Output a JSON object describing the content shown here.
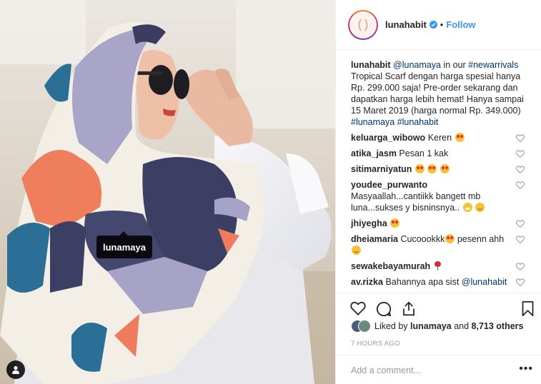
{
  "photo": {
    "tag_label": "lunamaya",
    "colors": {
      "scarf_cream": "#f3efe6",
      "scarf_navy": "#3c3e63",
      "scarf_lavender": "#a7a3c6",
      "scarf_coral": "#ee7b5d",
      "scarf_teal": "#2c6f96"
    }
  },
  "header": {
    "username": "lunahabit",
    "separator": "•",
    "follow_label": "Follow"
  },
  "caption": {
    "username": "lunahabit",
    "mention": "@lunamaya",
    "text_1": " in our ",
    "hashtag_1": "#newarrivals",
    "text_2": " Tropical Scarf dengan harga spesial hanya Rp. 299.000 saja! Pre-order sekarang dan dapatkan harga lebih hemat! Hanya sampai 15 Maret 2019 (harga normal Rp. 349.000) ",
    "hashtag_2": "#lunamaya",
    "hashtag_3": "#lunahabit"
  },
  "comments": [
    {
      "user": "keluarga_wibowo",
      "text": "Keren"
    },
    {
      "user": "atika_jasm",
      "text": "Pesan 1 kak"
    },
    {
      "user": "sitimarniyatun",
      "text": ""
    },
    {
      "user": "youdee_purwanto",
      "text": "Masyaallah...cantiikk bangett mb luna...sukses y bisninsnya.."
    },
    {
      "user": "jhiyegha",
      "text": ""
    },
    {
      "user": "dheiamaria",
      "text": "Cucoookkk",
      "text_after": " pesenn ahh"
    },
    {
      "user": "sewakebayamurah",
      "text": ""
    },
    {
      "user": "av.rizka",
      "text": "Bahannya apa sist ",
      "mention": "@lunahabit"
    }
  ],
  "likes": {
    "prefix": "Liked by ",
    "user": "lunamaya",
    "middle": " and ",
    "count": "8,713 others"
  },
  "timestamp": "7 HOURS AGO",
  "add_comment": {
    "placeholder": "Add a comment...",
    "more": "•••"
  },
  "icons": {
    "like": "heart-icon",
    "comment": "comment-icon",
    "share": "share-icon",
    "save": "bookmark-icon",
    "verified": "verified-badge-icon",
    "tag": "user-tag-icon"
  },
  "colors": {
    "link": "#003569",
    "follow": "#3897f0",
    "muted": "#999999",
    "text": "#262626"
  }
}
